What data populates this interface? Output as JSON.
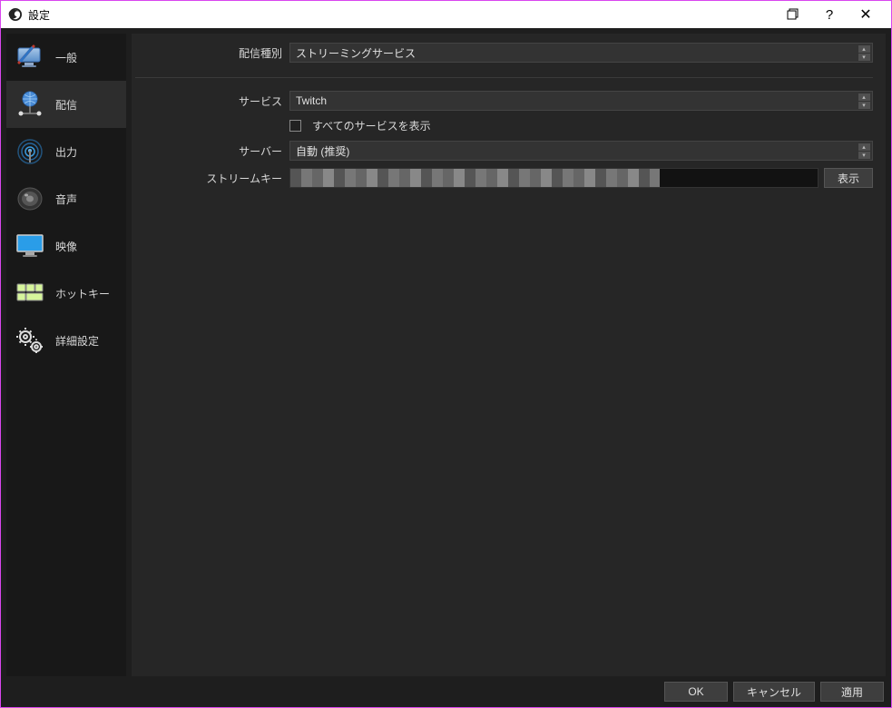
{
  "window": {
    "title": "設定"
  },
  "sidebar": {
    "items": [
      {
        "label": "一般"
      },
      {
        "label": "配信"
      },
      {
        "label": "出力"
      },
      {
        "label": "音声"
      },
      {
        "label": "映像"
      },
      {
        "label": "ホットキー"
      },
      {
        "label": "詳細設定"
      }
    ],
    "selected_index": 1
  },
  "form": {
    "stream_type_label": "配信種別",
    "stream_type_value": "ストリーミングサービス",
    "service_label": "サービス",
    "service_value": "Twitch",
    "show_all_label": "すべてのサービスを表示",
    "server_label": "サーバー",
    "server_value": "自動 (推奨)",
    "stream_key_label": "ストリームキー",
    "show_button": "表示"
  },
  "footer": {
    "ok": "OK",
    "cancel": "キャンセル",
    "apply": "適用"
  }
}
